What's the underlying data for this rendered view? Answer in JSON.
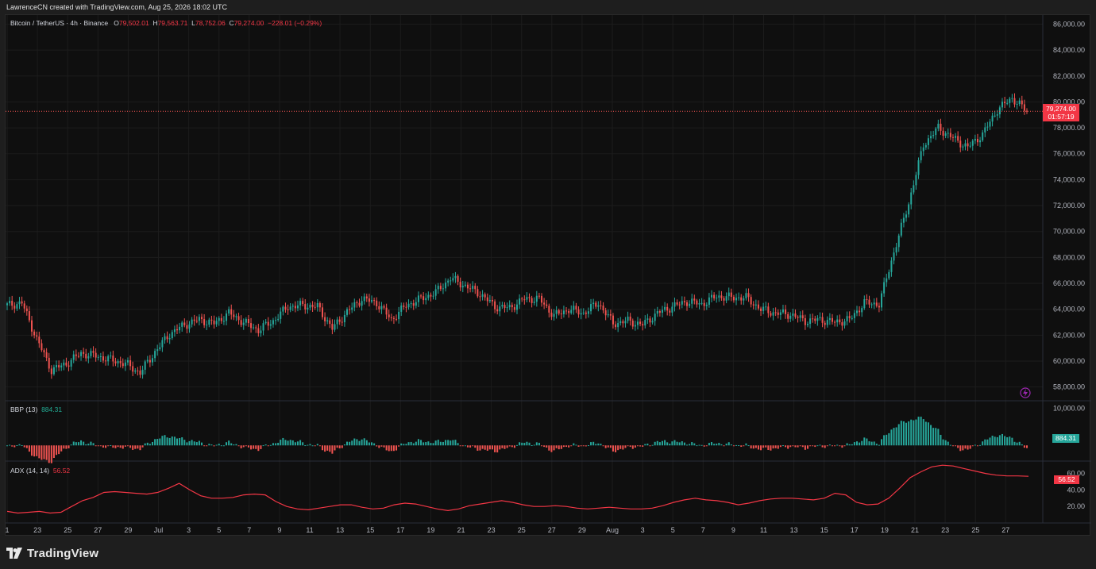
{
  "caption": "LawrenceCN created with TradingView.com, Aug 25, 2026 18:02 UTC",
  "footer": {
    "brand": "TradingView"
  },
  "legend": {
    "symbol": "Bitcoin / TetherUS · 4h · Binance",
    "o_label": "O",
    "o_value": "79,502.01",
    "h_label": "H",
    "h_value": "79,563.71",
    "l_label": "L",
    "l_value": "78,752.06",
    "c_label": "C",
    "c_value": "79,274.00",
    "change": "−228.01 (−0.29%)"
  },
  "current_price": {
    "value": "79,274.00",
    "countdown": "01:57:19"
  },
  "bbp": {
    "label": "BBP (13)",
    "value": "884.31",
    "axis_value": "884.31"
  },
  "adx": {
    "label": "ADX (14, 14)",
    "value": "56.52",
    "axis_value": "56.52"
  },
  "colors": {
    "up": "#26a69a",
    "down": "#ef5350",
    "adx_line": "#f23645",
    "grid": "#1c1c1c",
    "background": "#0f0f0f"
  },
  "chart_data": {
    "type": "candlestick",
    "title": "Bitcoin / TetherUS · 4h · Binance",
    "y_axis_ticks": [
      "58,000.00",
      "60,000.00",
      "62,000.00",
      "64,000.00",
      "66,000.00",
      "68,000.00",
      "70,000.00",
      "72,000.00",
      "74,000.00",
      "76,000.00",
      "78,000.00",
      "80,000.00",
      "82,000.00",
      "84,000.00",
      "86,000.00"
    ],
    "ylim": [
      57000,
      86700
    ],
    "x_axis_ticks": [
      "1",
      "23",
      "25",
      "27",
      "29",
      "Jul",
      "3",
      "5",
      "7",
      "9",
      "11",
      "13",
      "15",
      "17",
      "19",
      "21",
      "23",
      "25",
      "27",
      "29",
      "Aug",
      "3",
      "5",
      "7",
      "9",
      "11",
      "13",
      "15",
      "17",
      "19",
      "21",
      "23",
      "25",
      "27"
    ],
    "close_anchors": [
      [
        "1",
        64300
      ],
      [
        "22",
        64500
      ],
      [
        "23",
        61700
      ],
      [
        "24",
        59300
      ],
      [
        "25",
        59800
      ],
      [
        "26",
        60600
      ],
      [
        "27",
        60400
      ],
      [
        "28",
        60100
      ],
      [
        "29",
        59800
      ],
      [
        "30",
        59100
      ],
      [
        "Jul",
        60700
      ],
      [
        "2",
        62100
      ],
      [
        "3",
        62800
      ],
      [
        "4",
        63200
      ],
      [
        "5",
        62900
      ],
      [
        "6",
        63700
      ],
      [
        "7",
        63000
      ],
      [
        "8",
        62400
      ],
      [
        "9",
        63100
      ],
      [
        "10",
        64200
      ],
      [
        "11",
        64300
      ],
      [
        "12",
        64200
      ],
      [
        "13",
        62500
      ],
      [
        "14",
        63800
      ],
      [
        "15",
        64800
      ],
      [
        "16",
        64500
      ],
      [
        "17",
        63200
      ],
      [
        "18",
        64300
      ],
      [
        "19",
        64800
      ],
      [
        "20",
        65300
      ],
      [
        "21",
        66400
      ],
      [
        "22",
        65800
      ],
      [
        "23",
        65200
      ],
      [
        "24",
        64200
      ],
      [
        "25",
        64100
      ],
      [
        "26",
        64800
      ],
      [
        "27",
        64800
      ],
      [
        "28",
        63500
      ],
      [
        "29",
        64000
      ],
      [
        "30",
        63700
      ],
      [
        "31",
        64500
      ],
      [
        "Aug",
        62900
      ],
      [
        "2",
        63100
      ],
      [
        "3",
        62800
      ],
      [
        "4",
        63700
      ],
      [
        "5",
        64200
      ],
      [
        "6",
        64600
      ],
      [
        "7",
        64400
      ],
      [
        "8",
        65000
      ],
      [
        "9",
        64900
      ],
      [
        "10",
        64900
      ],
      [
        "11",
        64000
      ],
      [
        "12",
        63700
      ],
      [
        "13",
        63600
      ],
      [
        "14",
        63100
      ],
      [
        "15",
        63200
      ],
      [
        "16",
        63000
      ],
      [
        "17",
        63200
      ],
      [
        "18",
        64500
      ],
      [
        "19",
        64400
      ],
      [
        "19b",
        68400
      ],
      [
        "20",
        72200
      ],
      [
        "20b",
        76700
      ],
      [
        "21",
        78000
      ],
      [
        "22",
        77200
      ],
      [
        "23",
        76500
      ],
      [
        "24",
        77500
      ],
      [
        "25",
        79400
      ],
      [
        "25b",
        80300
      ],
      [
        "26",
        79274
      ]
    ],
    "bbp": {
      "ylim": [
        -4000,
        12000
      ],
      "ticks": [
        "10,000.00"
      ],
      "last": 884.31
    },
    "adx": {
      "ylim": [
        0,
        75
      ],
      "ticks": [
        "20.00",
        "40.00",
        "60.00"
      ],
      "values": [
        14,
        12,
        13,
        14,
        12,
        13,
        20,
        27,
        31,
        37,
        38,
        37,
        36,
        35,
        37,
        42,
        48,
        40,
        33,
        30,
        30,
        31,
        34,
        35,
        34,
        26,
        20,
        17,
        16,
        18,
        20,
        22,
        22,
        19,
        17,
        18,
        22,
        24,
        23,
        20,
        17,
        15,
        17,
        21,
        23,
        25,
        27,
        25,
        22,
        20,
        20,
        21,
        20,
        18,
        17,
        18,
        19,
        18,
        17,
        17,
        18,
        21,
        25,
        28,
        30,
        28,
        27,
        25,
        22,
        24,
        27,
        29,
        30,
        30,
        29,
        28,
        30,
        36,
        34,
        25,
        22,
        23,
        30,
        42,
        55,
        62,
        68,
        70,
        69,
        66,
        63,
        60,
        58,
        57,
        57,
        56.52
      ]
    }
  }
}
